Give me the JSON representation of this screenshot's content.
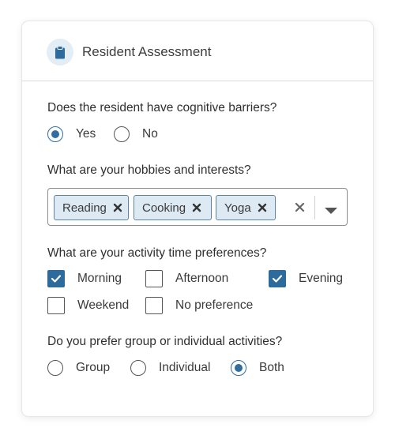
{
  "header": {
    "title": "Resident Assessment",
    "icon": "clipboard-icon"
  },
  "q1": {
    "question": "Does the resident have cognitive barriers?",
    "options": [
      {
        "label": "Yes",
        "checked": true
      },
      {
        "label": "No",
        "checked": false
      }
    ]
  },
  "q2": {
    "question": "What are your hobbies and interests?",
    "selected": [
      "Reading",
      "Cooking",
      "Yoga"
    ]
  },
  "q3": {
    "question": "What are your activity time preferences?",
    "options": [
      {
        "label": "Morning",
        "checked": true
      },
      {
        "label": "Afternoon",
        "checked": false
      },
      {
        "label": "Evening",
        "checked": true
      },
      {
        "label": "Weekend",
        "checked": false
      },
      {
        "label": "No preference",
        "checked": false
      }
    ]
  },
  "q4": {
    "question": "Do you prefer group or individual activities?",
    "options": [
      {
        "label": "Group",
        "checked": false
      },
      {
        "label": "Individual",
        "checked": false
      },
      {
        "label": "Both",
        "checked": true
      }
    ]
  },
  "colors": {
    "accent": "#2d6b9c",
    "chip_bg": "#dde9f3",
    "chip_border": "#5b84a8"
  }
}
